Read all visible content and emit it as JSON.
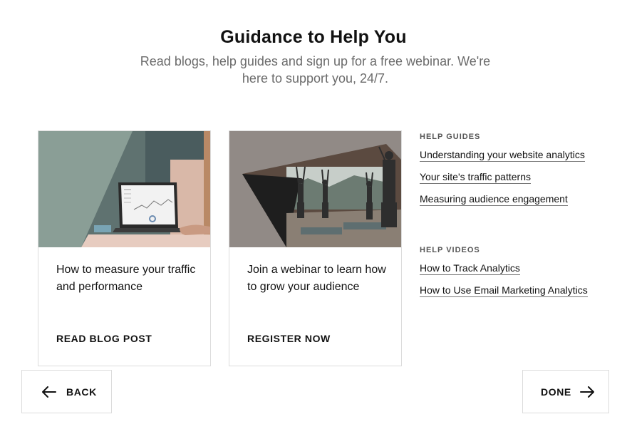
{
  "header": {
    "title": "Guidance to Help You",
    "subtitle": "Read blogs, help guides and sign up for a free webinar. We're here to support you, 24/7."
  },
  "cards": [
    {
      "text": "How to measure your traffic and performance",
      "cta": "READ BLOG POST",
      "image": "laptop-analytics-image"
    },
    {
      "text": "Join a webinar to learn how to grow your audience",
      "cta": "REGISTER NOW",
      "image": "yoga-class-image"
    }
  ],
  "help_guides": {
    "heading": "HELP GUIDES",
    "links": [
      "Understanding your website analytics",
      "Your site's traffic patterns",
      "Measuring audience engagement"
    ]
  },
  "help_videos": {
    "heading": "HELP VIDEOS",
    "links": [
      "How to Track Analytics",
      "How to Use Email Marketing Analytics"
    ]
  },
  "nav": {
    "back_label": "BACK",
    "back_icon": "arrow-left-icon",
    "done_label": "DONE",
    "done_icon": "arrow-right-icon"
  },
  "colors": {
    "text": "#111111",
    "subtitle": "#6b6b6b",
    "border": "#dcdcdc",
    "sage": "#8a9e96",
    "warm_gray": "#918a86"
  }
}
